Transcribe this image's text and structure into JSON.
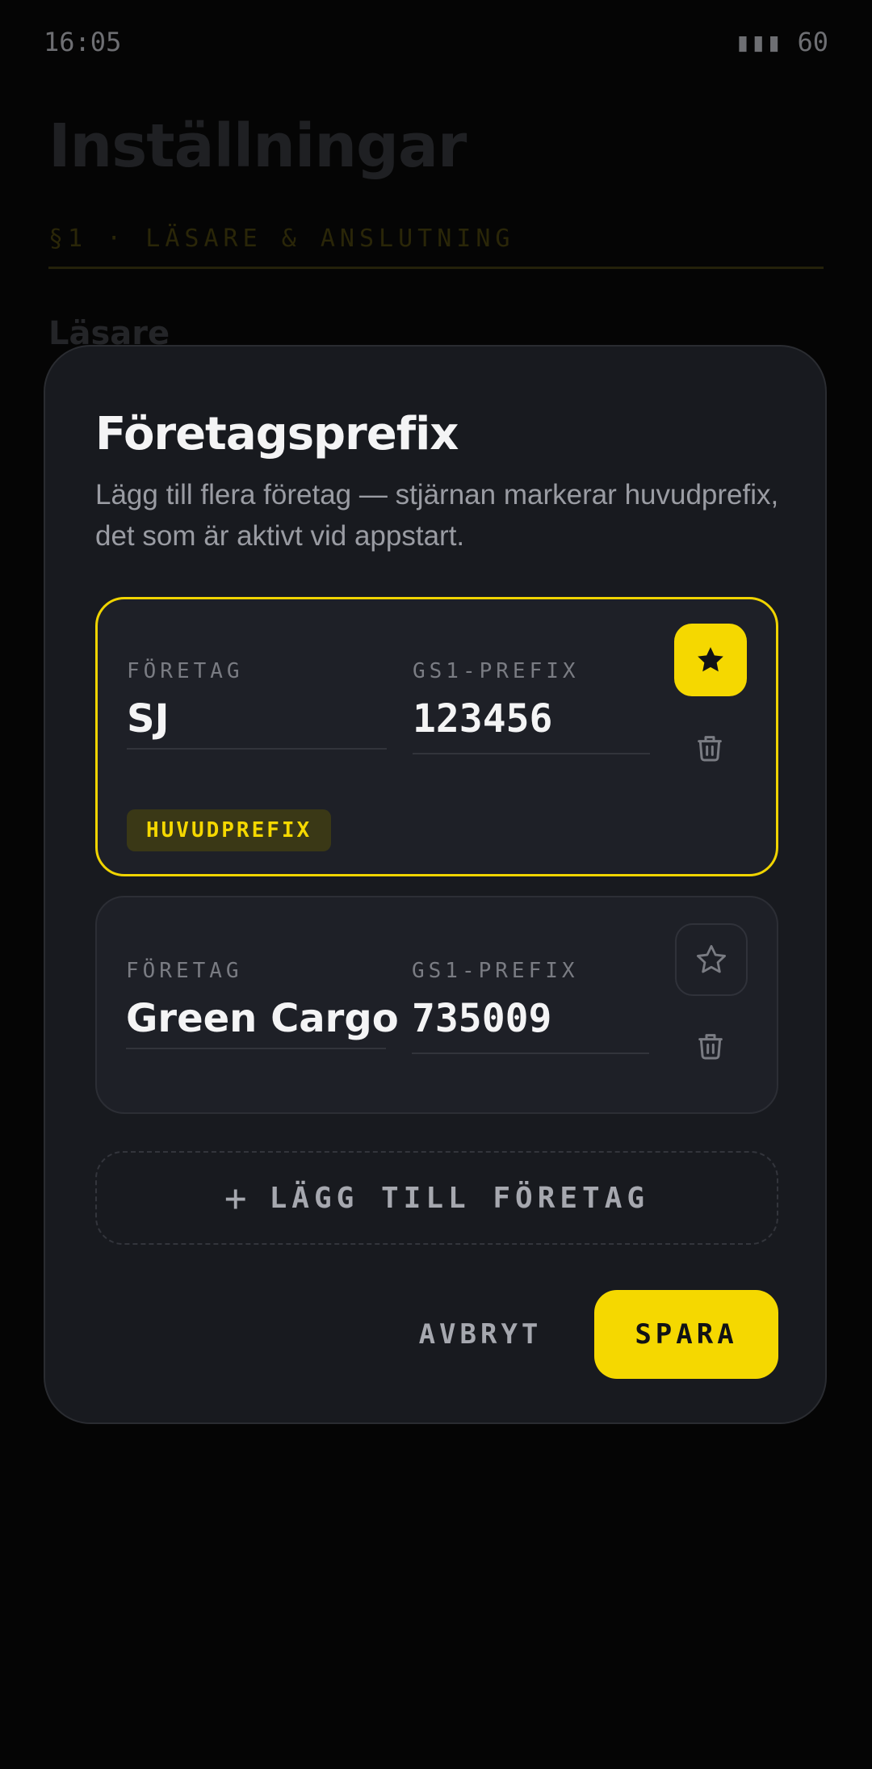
{
  "status_bar": {
    "time": "16:05",
    "battery": "▮▮▮ 60"
  },
  "background": {
    "title": "Inställningar",
    "section": "§1 · LÄSARE & ANSLUTNING",
    "subheading": "Läsare"
  },
  "modal": {
    "title": "Företagsprefix",
    "description": "Lägg till flera företag — stjärnan markerar huvudprefix, det som är aktivt vid appstart.",
    "companies": [
      {
        "company_label": "FÖRETAG",
        "company": "SJ",
        "prefix_label": "GS1-PREFIX",
        "prefix": "123456",
        "primary": true,
        "badge": "HUVUDPREFIX"
      },
      {
        "company_label": "FÖRETAG",
        "company": "Green Cargo",
        "prefix_label": "GS1-PREFIX",
        "prefix": "735009",
        "primary": false
      }
    ],
    "add_button": {
      "icon": "+",
      "label": "LÄGG TILL FÖRETAG"
    },
    "cancel_label": "AVBRYT",
    "save_label": "SPARA"
  },
  "colors": {
    "accent": "#f5d800",
    "modal_bg": "#181a1f",
    "card_bg": "#1e2027"
  },
  "icons": {
    "star_filled": "star-filled-icon",
    "star_outline": "star-outline-icon",
    "trash": "trash-icon",
    "plus": "plus-icon"
  }
}
